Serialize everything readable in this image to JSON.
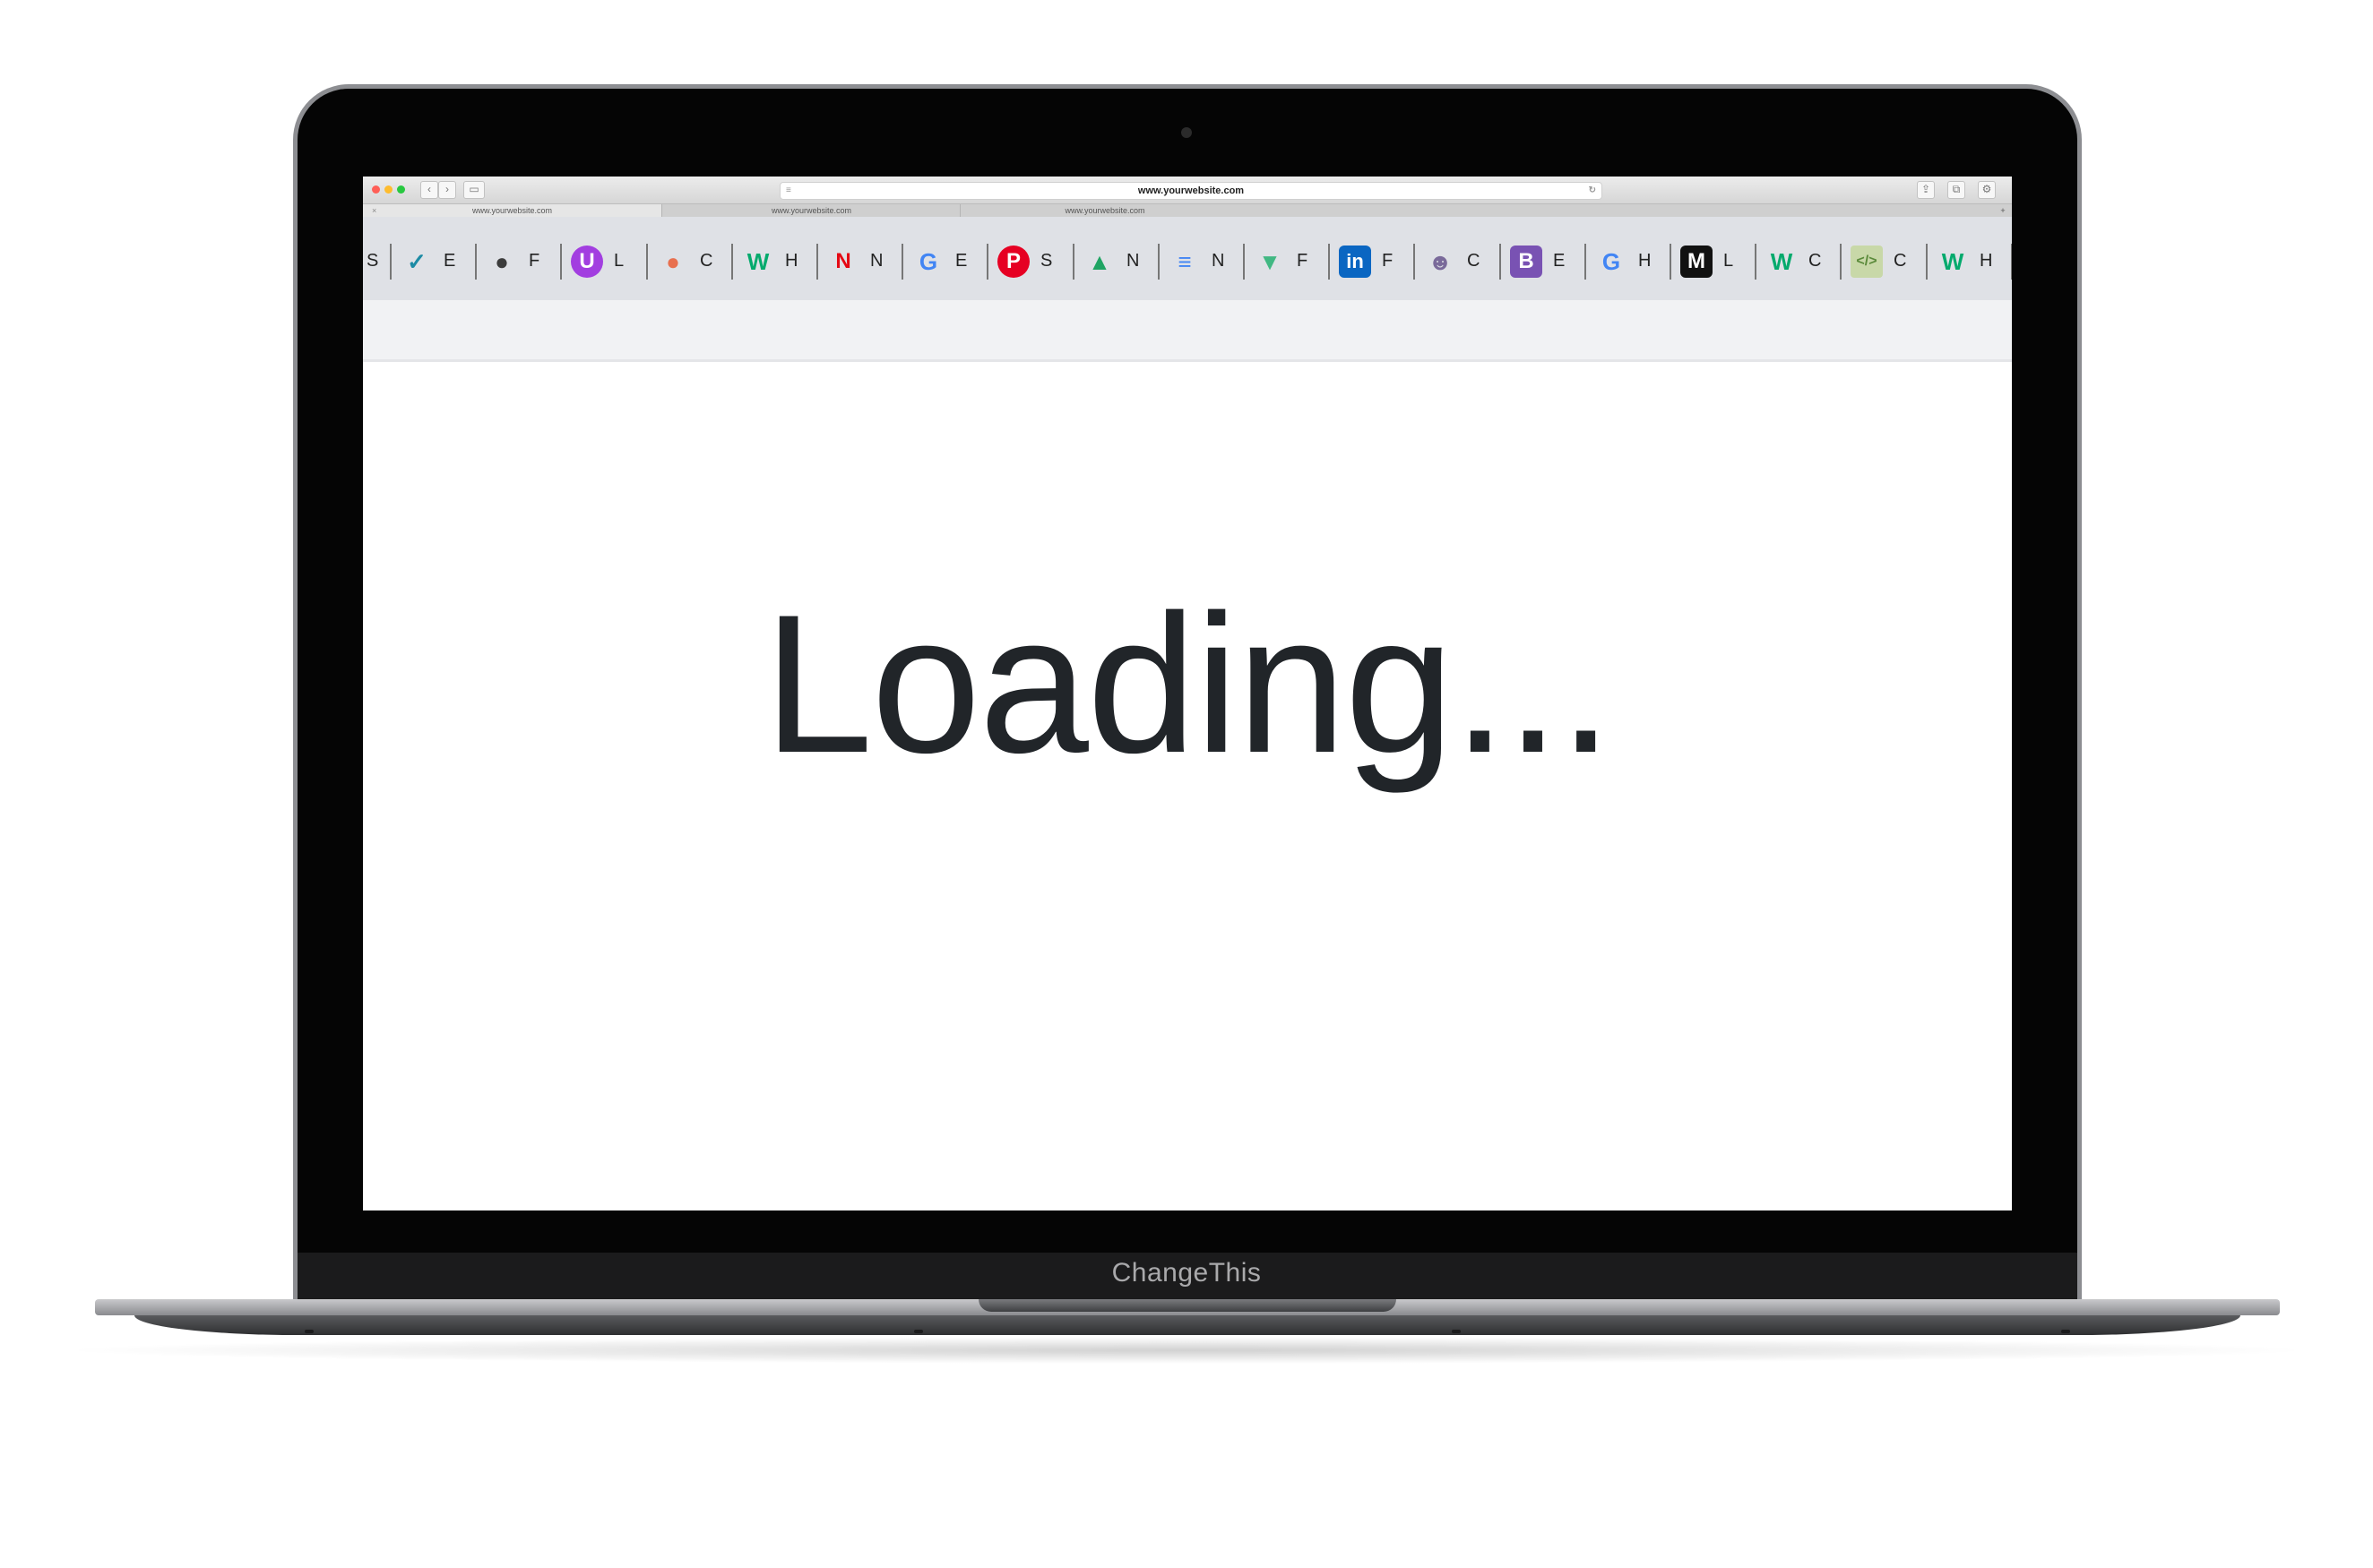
{
  "browser": {
    "address": "www.yourwebsite.com",
    "tabs": [
      {
        "label": "www.yourwebsite.com",
        "active": true
      },
      {
        "label": "www.yourwebsite.com",
        "active": false
      },
      {
        "label": "www.yourwebsite.com",
        "active": false
      }
    ],
    "tab_close": "×",
    "tab_add": "+"
  },
  "bookmarks": [
    {
      "icon": "check-diamond-icon",
      "glyph": "✓",
      "color": "#1d8ba5",
      "label": "E"
    },
    {
      "icon": "globe-icon",
      "glyph": "●",
      "color": "#3c3c3c",
      "label": "F"
    },
    {
      "icon": "u-circle-icon",
      "glyph": "U",
      "color": "#a23ee0",
      "label": "L"
    },
    {
      "icon": "sunset-icon",
      "glyph": "●",
      "color": "#e8704f",
      "label": "C"
    },
    {
      "icon": "w3schools-icon",
      "glyph": "W",
      "color": "#04aa6d",
      "label": "H"
    },
    {
      "icon": "netflix-icon",
      "glyph": "N",
      "color": "#e50914",
      "label": "N"
    },
    {
      "icon": "google-icon",
      "glyph": "G",
      "color": "#4285f4",
      "label": "E"
    },
    {
      "icon": "pinterest-icon",
      "glyph": "P",
      "color": "#e60023",
      "label": "S"
    },
    {
      "icon": "google-drive-icon",
      "glyph": "▲",
      "color": "#1fa463",
      "label": "N"
    },
    {
      "icon": "google-docs-icon",
      "glyph": "≡",
      "color": "#4285f4",
      "label": "N"
    },
    {
      "icon": "vue-icon",
      "glyph": "▼",
      "color": "#41b883",
      "label": "F"
    },
    {
      "icon": "linkedin-icon",
      "glyph": "in",
      "color": "#0a66c2",
      "label": "F"
    },
    {
      "icon": "person-icon",
      "glyph": "☻",
      "color": "#7a6a9a",
      "label": "C"
    },
    {
      "icon": "bootstrap-icon",
      "glyph": "B",
      "color": "#7952b3",
      "label": "E"
    },
    {
      "icon": "google-icon",
      "glyph": "G",
      "color": "#4285f4",
      "label": "H"
    },
    {
      "icon": "medium-icon",
      "glyph": "M",
      "color": "#111111",
      "label": "L"
    },
    {
      "icon": "w3schools-icon",
      "glyph": "W",
      "color": "#04aa6d",
      "label": "C"
    },
    {
      "icon": "code-editor-icon",
      "glyph": "</>",
      "color": "#5a8a3a",
      "label": "C"
    },
    {
      "icon": "w3schools-icon",
      "glyph": "W",
      "color": "#04aa6d",
      "label": "H"
    }
  ],
  "bookmark_leading_label": "S",
  "page": {
    "message": "Loading..."
  },
  "laptop": {
    "brand": "ChangeThis"
  }
}
